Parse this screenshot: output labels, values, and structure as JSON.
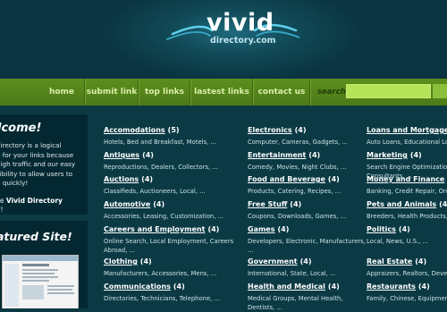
{
  "header": {
    "logo_main": "vivid",
    "logo_sub": "directory.com"
  },
  "nav": {
    "items": [
      {
        "label": "home"
      },
      {
        "label": "submit link"
      },
      {
        "label": "top links"
      },
      {
        "label": "lastest links"
      },
      {
        "label": "contact us"
      }
    ],
    "search_label": "search",
    "search_value": ""
  },
  "sidebar": {
    "welcome_title": "lcome!",
    "welcome_lines": [
      "directory is a logical",
      "e for your links because",
      "high traffic and our easy",
      "sibility to allow users to",
      "h quickly!"
    ],
    "welcome_tag_prefix": "se ",
    "welcome_tag_name": "Vivid Directory",
    "welcome_tag_suffix": "y!",
    "featured_title": "atured Site!"
  },
  "columns": [
    {
      "categories": [
        {
          "name": "Accomodations",
          "count": "(5)",
          "subs": [
            "Hotels, Bed and Breakfast, Motels, ..."
          ]
        },
        {
          "name": "Antiques",
          "count": "(4)",
          "subs": [
            "Reproductions, Dealers, Collectors, ..."
          ]
        },
        {
          "name": "Auctions",
          "count": "(4)",
          "subs": [
            "Classifieds, Auctioneers, Local, ..."
          ]
        },
        {
          "name": "Automotive",
          "count": "(4)",
          "subs": [
            "Accessories, Leasing, Customization, ..."
          ]
        },
        {
          "name": "Careers and Employment",
          "count": "(4)",
          "subs": [
            "Online Search, Local Employment, Careers",
            "Abroad, ..."
          ]
        },
        {
          "name": "Clothing",
          "count": "(4)",
          "subs": [
            "Manufacturers, Accessories, Mens, ..."
          ]
        },
        {
          "name": "Communications",
          "count": "(4)",
          "subs": [
            "Directories, Technicians, Telephone, ..."
          ]
        }
      ]
    },
    {
      "categories": [
        {
          "name": "Electronics",
          "count": "(4)",
          "subs": [
            "Computer, Cameras, Gadgets, ..."
          ]
        },
        {
          "name": "Entertainment",
          "count": "(4)",
          "subs": [
            "Comedy, Movies, Night Clubs, ..."
          ]
        },
        {
          "name": "Food and Beverage",
          "count": "(4)",
          "subs": [
            "Products, Catering, Recipes, ..."
          ]
        },
        {
          "name": "Free Stuff",
          "count": "(4)",
          "subs": [
            "Coupons, Downloads, Games, ..."
          ]
        },
        {
          "name": "Games",
          "count": "(4)",
          "subs": [
            "Developers, Electronic, Manufacturers,",
            "..."
          ]
        },
        {
          "name": "Government",
          "count": "(4)",
          "subs": [
            "International, State, Local, ..."
          ]
        },
        {
          "name": "Health and Medical",
          "count": "(4)",
          "subs": [
            "Medical Groups, Mental Health,",
            "Dentists, ..."
          ]
        }
      ]
    },
    {
      "categories": [
        {
          "name": "Loans and Mortgage",
          "count": "(4)",
          "subs": [
            "Auto Loans, Educational Loa"
          ]
        },
        {
          "name": "Marketing",
          "count": "(4)",
          "subs": [
            "Search Engine Optimization,",
            "Consultants, ..."
          ]
        },
        {
          "name": "Money and Finance",
          "count": "(4)",
          "subs": [
            "Banking, Credit Repair, Onlin"
          ]
        },
        {
          "name": "Pets and Animals",
          "count": "(4)",
          "subs": [
            "Breeders, Health Products, S"
          ]
        },
        {
          "name": "Politics",
          "count": "(4)",
          "subs": [
            "Local, News, U.S., ..."
          ]
        },
        {
          "name": "Real Estate",
          "count": "(4)",
          "subs": [
            "Appraizers, Realtors, Develo"
          ]
        },
        {
          "name": "Restaurants",
          "count": "(4)",
          "subs": [
            "Family, Chinese, Equipmen"
          ]
        }
      ]
    }
  ]
}
